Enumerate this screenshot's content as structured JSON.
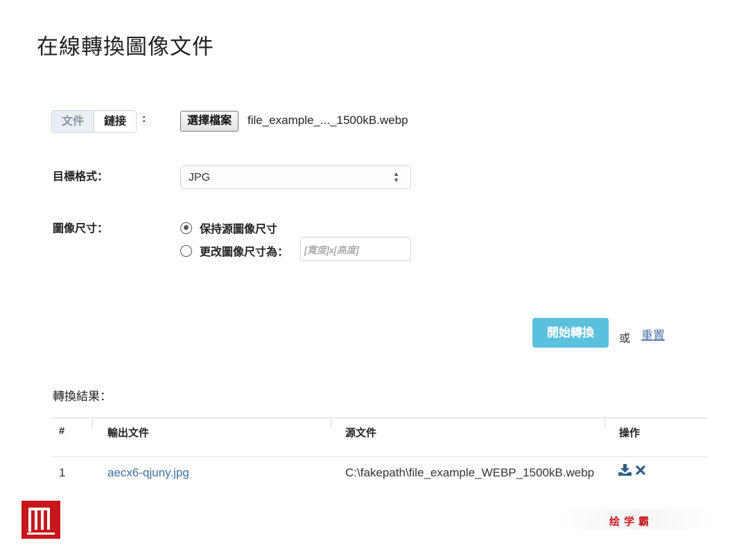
{
  "page": {
    "title": "在線轉換圖像文件"
  },
  "source": {
    "tabs": [
      {
        "label": "文件",
        "active": true
      },
      {
        "label": "鏈接",
        "active": false
      }
    ],
    "colon": ":",
    "choose_button": "選擇檔案",
    "file_name": "file_example_..._1500kB.webp"
  },
  "format": {
    "label": "目標格式：",
    "selected": "JPG"
  },
  "image_size": {
    "label": "圖像尺寸：",
    "options": [
      {
        "label": "保持源圖像尺寸",
        "checked": true
      },
      {
        "label": "更改圖像尺寸為：",
        "checked": false
      }
    ],
    "placeholder": "[寬度]x[高度]"
  },
  "actions": {
    "convert_label": "開始轉換",
    "or_text": "或",
    "reset_label": "重置"
  },
  "results": {
    "heading": "轉換結果：",
    "columns": [
      "#",
      "輸出文件",
      "源文件",
      "操作"
    ],
    "rows": [
      {
        "index": "1",
        "output": "aecx6-qjuny.jpg",
        "source": "C:\\fakepath\\file_example_WEBP_1500kB.webp",
        "actions": [
          "download-icon",
          "close-icon"
        ]
      }
    ]
  },
  "watermark": {
    "text": "绘学霸",
    "logo_color": "#c8161d"
  },
  "colors": {
    "accent": "#5bc0de",
    "link": "#3a6ea5"
  }
}
